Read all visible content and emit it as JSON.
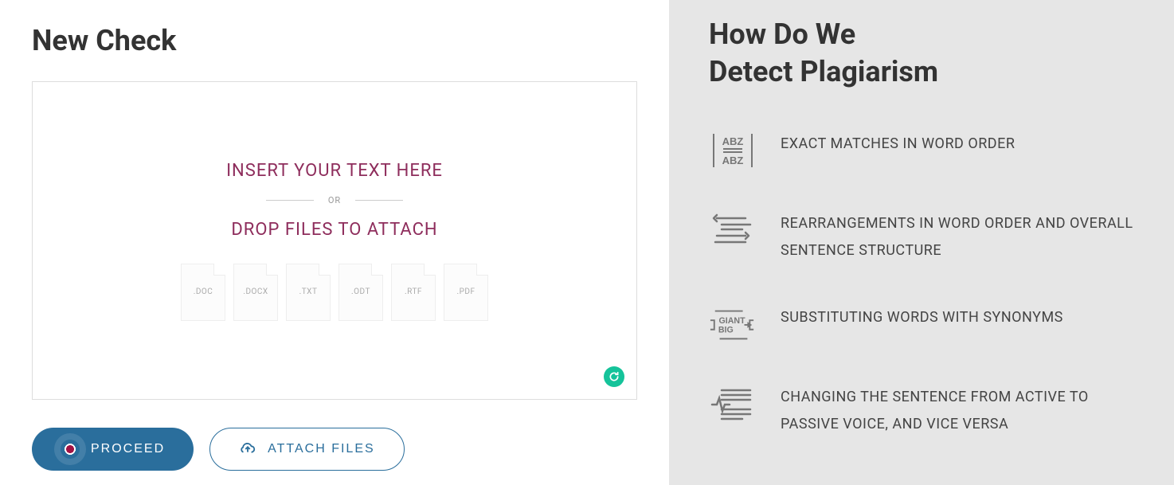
{
  "left": {
    "title": "New Check",
    "dropzone": {
      "line1": "INSERT YOUR TEXT HERE",
      "divider": "OR",
      "line2": "DROP FILES TO ATTACH",
      "formats": [
        ".DOC",
        ".DOCX",
        ".TXT",
        ".ODT",
        ".RTF",
        ".PDF"
      ]
    },
    "buttons": {
      "proceed": "PROCEED",
      "attach": "ATTACH FILES"
    }
  },
  "right": {
    "title": "How Do We Detect Plagiarism",
    "features": [
      {
        "icon": "abz-match-icon",
        "text": "EXACT MATCHES IN WORD ORDER"
      },
      {
        "icon": "rearrange-icon",
        "text": "REARRANGEMENTS IN WORD ORDER AND OVERALL SENTENCE STRUCTURE"
      },
      {
        "icon": "synonym-icon",
        "text": "SUBSTITUTING WORDS WITH SYNONYMS"
      },
      {
        "icon": "voice-change-icon",
        "text": "CHANGING THE SENTENCE FROM ACTIVE TO PASSIVE VOICE, AND VICE VERSA"
      }
    ]
  }
}
